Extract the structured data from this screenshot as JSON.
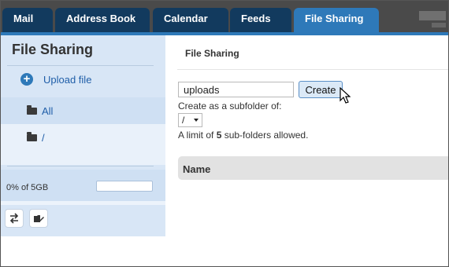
{
  "tabs": {
    "mail": "Mail",
    "address_book": "Address Book",
    "calendar": "Calendar",
    "feeds": "Feeds",
    "file_sharing": "File Sharing"
  },
  "sidebar": {
    "title": "File Sharing",
    "upload_label": "Upload file",
    "folders": [
      {
        "label": "All",
        "selected": true
      },
      {
        "label": "/",
        "selected": false
      }
    ],
    "quota_label": "0% of 5GB",
    "quota_fraction": 0
  },
  "main": {
    "title": "File Sharing",
    "folder_name_value": "uploads",
    "create_label": "Create",
    "subfolder_label": "Create as a subfolder of:",
    "parent_folder_value": "/",
    "limit_prefix": "A limit of ",
    "limit_count": "5",
    "limit_suffix": " sub-folders allowed.",
    "table_header_name": "Name"
  },
  "colors": {
    "tab_active": "#2e79b9",
    "tab_inactive": "#123a5e",
    "sidebar_bg": "#d8e6f6",
    "link": "#1f5ea8"
  },
  "icons": [
    "plus-icon",
    "folder-icon",
    "sync-icon",
    "new-folder-icon",
    "mouse-cursor-icon",
    "chevron-down-icon"
  ]
}
